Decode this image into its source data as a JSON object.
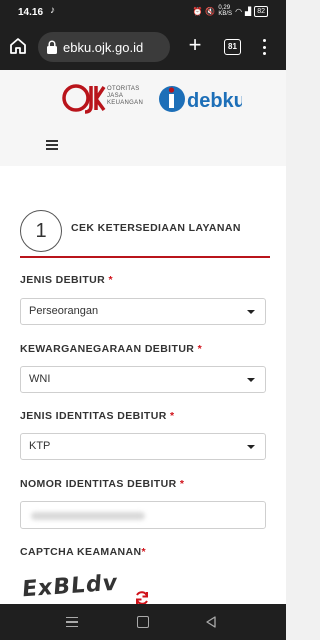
{
  "status": {
    "time": "14.16",
    "network_speed": "0,29\nKB/S",
    "battery": "82"
  },
  "browser": {
    "url": "ebku.ojk.go.id",
    "url_prefix": "i",
    "tab_count": "81"
  },
  "header": {
    "ojk_mark": "OJK",
    "ojk_line1": "OTORITAS",
    "ojk_line2": "JASA",
    "ojk_line3": "KEUANGAN",
    "idebku_mark": "idebku"
  },
  "form": {
    "step_number": "1",
    "step_title": "CEK KETERSEDIAAN LAYANAN",
    "required_mark": "*",
    "fields": [
      {
        "label": "JENIS DEBITUR",
        "value": "Perseorangan"
      },
      {
        "label": "KEWARGANEGARAAN DEBITUR",
        "value": "WNI"
      },
      {
        "label": "JENIS IDENTITAS DEBITUR",
        "value": "KTP"
      },
      {
        "label": "NOMOR IDENTITAS DEBITUR",
        "value": ""
      }
    ],
    "captcha_label": "CAPTCHA KEAMANAN",
    "captcha_text": "ExBLdv"
  },
  "colors": {
    "brand_red": "#b9141b",
    "required_red": "#d0121a",
    "idebku_blue": "#1d6fb8"
  }
}
